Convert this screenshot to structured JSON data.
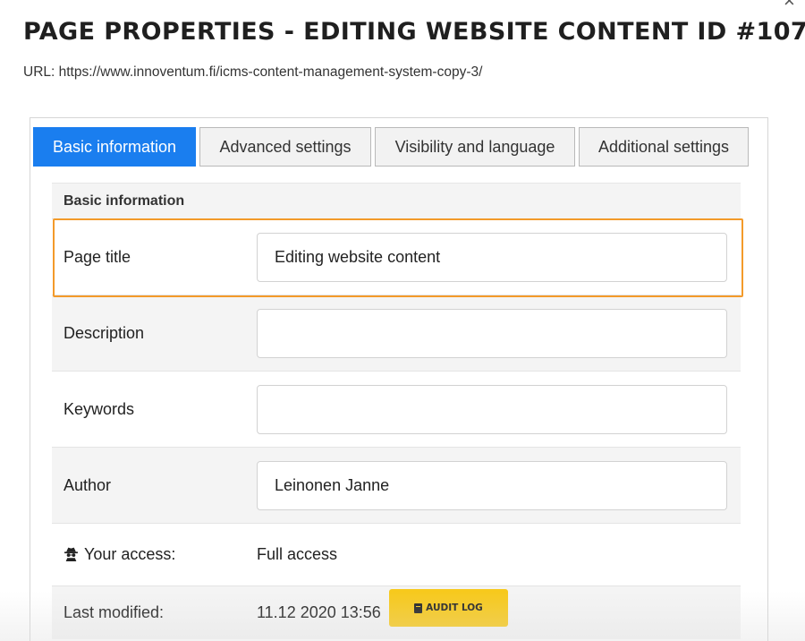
{
  "dialog": {
    "title": "PAGE PROPERTIES - EDITING WEBSITE CONTENT ID #107",
    "url": "URL: https://www.innoventum.fi/icms-content-management-system-copy-3/",
    "close_icon": "close-icon",
    "close_symbol": "×"
  },
  "tabs": [
    {
      "label": "Basic information",
      "active": true
    },
    {
      "label": "Advanced settings",
      "active": false
    },
    {
      "label": "Visibility and language",
      "active": false
    },
    {
      "label": "Additional settings",
      "active": false
    }
  ],
  "form": {
    "section_title": "Basic information",
    "fields": [
      {
        "label": "Page title",
        "value": "Editing website content",
        "placeholder": ""
      },
      {
        "label": "Description",
        "value": "",
        "placeholder": ""
      },
      {
        "label": "Keywords",
        "value": "",
        "placeholder": ""
      },
      {
        "label": "Author",
        "value": "Leinonen Janne",
        "placeholder": ""
      }
    ],
    "access": {
      "label": "Your access:",
      "value": "Full access",
      "icon": "spy-icon"
    },
    "last_modified": {
      "label": "Last modified:",
      "value": "11.12 2020 13:56",
      "button_label": "AUDIT LOG",
      "button_icon": "book-icon"
    }
  },
  "colors": {
    "active_tab": "#1a7eef",
    "highlight_border": "#f39a2a",
    "audit_button": "#f7c91c"
  }
}
